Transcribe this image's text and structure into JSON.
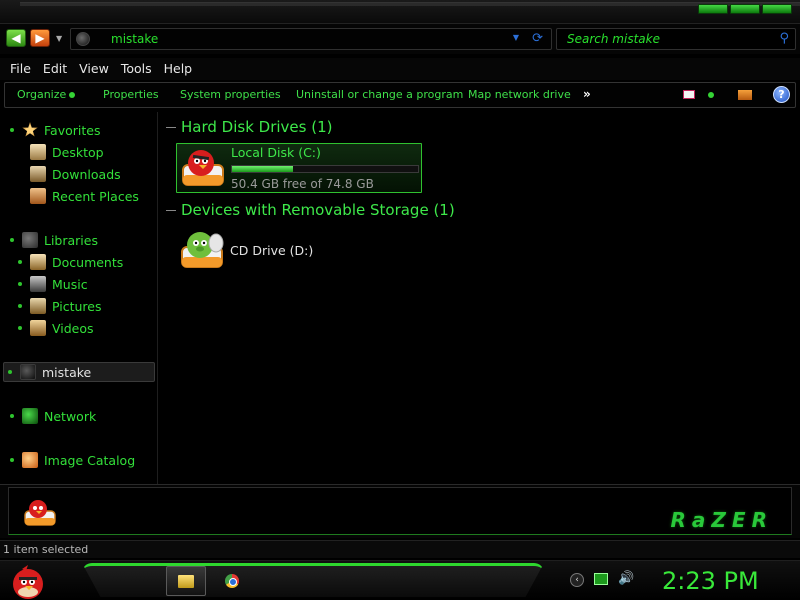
{
  "window": {
    "title_buttons": [
      "minimize",
      "maximize",
      "close"
    ]
  },
  "address": {
    "path": "mistake",
    "search_placeholder": "Search mistake",
    "icons": {
      "back": "back-arrow-icon",
      "forward": "forward-arrow-icon",
      "refresh": "refresh-icon",
      "search": "search-icon"
    }
  },
  "menu": {
    "items": [
      "File",
      "Edit",
      "View",
      "Tools",
      "Help"
    ]
  },
  "commands": {
    "organize": "Organize",
    "properties": "Properties",
    "system_properties": "System properties",
    "uninstall": "Uninstall or change a program",
    "map_drive": "Map network drive",
    "more": "»",
    "help": "?"
  },
  "nav": {
    "favorites": {
      "label": "Favorites",
      "items": [
        "Desktop",
        "Downloads",
        "Recent Places"
      ]
    },
    "libraries": {
      "label": "Libraries",
      "items": [
        "Documents",
        "Music",
        "Pictures",
        "Videos"
      ]
    },
    "current": "mistake",
    "network": "Network",
    "image_catalog": "Image Catalog"
  },
  "content": {
    "group_hdd": "Hard Disk Drives (1)",
    "local_disk": {
      "label": "Local Disk (C:)",
      "free": "50.4 GB free of 74.8 GB",
      "used_fraction": 0.326
    },
    "group_removable": "Devices with Removable Storage (1)",
    "cd_drive": "CD Drive (D:)"
  },
  "details": {
    "brand": "RaZER"
  },
  "status": {
    "text": "1 item selected"
  },
  "taskbar": {
    "clock": "2:23 PM",
    "tray_more": "‹",
    "volume": "🔊"
  },
  "colors": {
    "accent": "#33e03a",
    "background": "#000000",
    "selection_border": "#2fc12f"
  }
}
